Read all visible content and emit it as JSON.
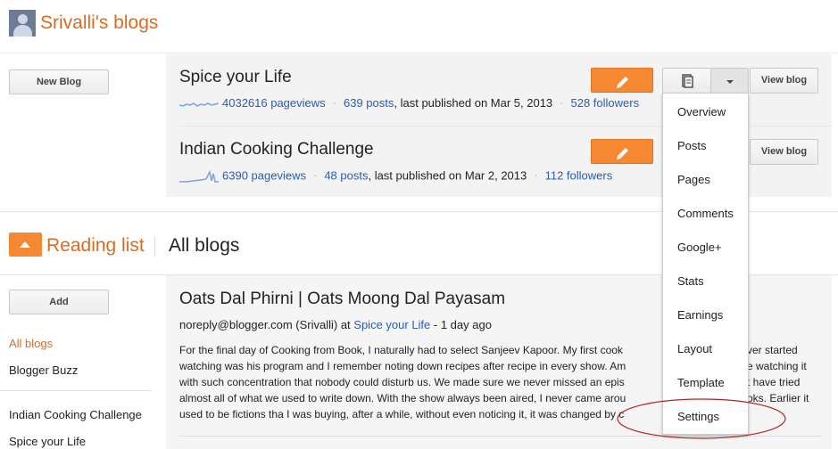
{
  "header": {
    "title": "Srivalli's blogs"
  },
  "buttons": {
    "new_blog": "New Blog",
    "view_blog": "View blog",
    "add": "Add"
  },
  "blogs": [
    {
      "title": "Spice your Life",
      "pageviews": "4032616 pageviews",
      "posts": "639 posts",
      "published": ", last published on Mar 5, 2013",
      "followers": "528 followers"
    },
    {
      "title": "Indian Cooking Challenge",
      "pageviews": "6390 pageviews",
      "posts": "48 posts",
      "published": ", last published on Mar 2, 2013",
      "followers": "112 followers"
    }
  ],
  "dropdown": {
    "items": [
      "Overview",
      "Posts",
      "Pages",
      "Comments",
      "Google+",
      "Stats",
      "Earnings",
      "Layout",
      "Template",
      "Settings"
    ]
  },
  "reading": {
    "title": "Reading list",
    "filter": "All blogs"
  },
  "sidebar": {
    "items": [
      "All blogs",
      "Blogger Buzz",
      "Indian Cooking Challenge",
      "Spice your Life"
    ]
  },
  "post": {
    "title": "Oats Dal Phirni | Oats Moong Dal Payasam",
    "author": "noreply@blogger.com (Srivalli) at ",
    "blog": "Spice your Life",
    "age": " - 1 day ago",
    "lines": [
      "For the final day of Cooking from Book, I naturally had to select Sanjeev Kapoor. My first cook",
      "watching was his program and I remember noting down recipes after recipe in every show. Am",
      "with such concentration that nobody could disturb us. We made sure we never missed an epis",
      "almost all of what we used to write down. With the show always been aired, I never came arou",
      "used to be fictions tha I was buying, after a while, without even noticing it, it was changed by c"
    ],
    "lines_right": [
      "ver started",
      "e watching it",
      "t have tried",
      "oks. Earlier it",
      ""
    ]
  },
  "colors": {
    "accent": "#f48833",
    "title_orange": "#dd6b1e",
    "link": "#2a5db0",
    "annotation": "#b22222"
  }
}
